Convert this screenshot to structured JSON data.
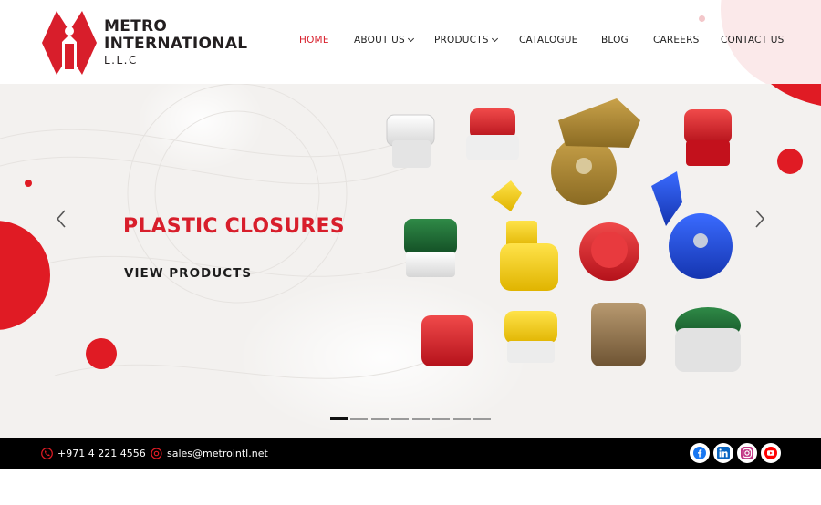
{
  "brand": {
    "name_line1": "METRO",
    "name_line2": "INTERNATIONAL",
    "name_line3": "L.L.C",
    "accent_color": "#d81e2b"
  },
  "nav": {
    "items": [
      {
        "label": "HOME",
        "active": true,
        "has_dropdown": false
      },
      {
        "label": "ABOUT US",
        "active": false,
        "has_dropdown": true
      },
      {
        "label": "PRODUCTS",
        "active": false,
        "has_dropdown": true
      },
      {
        "label": "CATALOGUE",
        "active": false,
        "has_dropdown": false
      },
      {
        "label": "BLOG",
        "active": false,
        "has_dropdown": false
      },
      {
        "label": "CAREERS",
        "active": false,
        "has_dropdown": false
      },
      {
        "label": "CONTACT US",
        "active": false,
        "has_dropdown": false
      }
    ]
  },
  "hero": {
    "title": "PLASTIC CLOSURES",
    "cta_label": "VIEW PRODUCTS",
    "prev_icon": "chevron-left-icon",
    "next_icon": "chevron-right-icon",
    "slide_count": 8,
    "active_slide": 1,
    "product_image": "assorted-plastic-caps-image"
  },
  "footer": {
    "phone": "+971 4 221 4556",
    "phone_icon": "phone-icon",
    "email": "sales@metrointl.net",
    "email_icon": "at-icon",
    "social": [
      {
        "name": "facebook-icon",
        "color": "#1877f2"
      },
      {
        "name": "linkedin-icon",
        "color": "#0a66c2"
      },
      {
        "name": "instagram-icon",
        "color": "#c13584"
      },
      {
        "name": "youtube-icon",
        "color": "#ff0000"
      }
    ]
  }
}
